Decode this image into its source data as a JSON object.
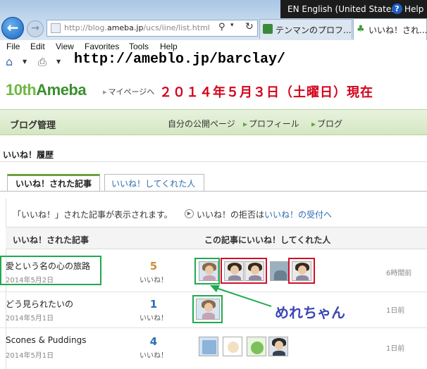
{
  "browser": {
    "language": "EN English (United States)",
    "help": "Help",
    "url_prefix": "http://blog.",
    "url_domain": "ameba.jp",
    "url_path": "/ucs/iine/list.html",
    "tabs": [
      {
        "label": "テンマンのプロフ..."
      },
      {
        "label": "いいね！され..."
      }
    ],
    "menu": [
      "File",
      "Edit",
      "View",
      "Favorites",
      "Tools",
      "Help"
    ],
    "overlay_url": "http://ameblo.jp/barclay/"
  },
  "site": {
    "logo_prefix": "10th",
    "logo_name": "Ameba",
    "mypage_link": "マイページへ",
    "date_note": "２０１４年５月３日（土曜日）現在"
  },
  "nav": {
    "title": "ブログ管理",
    "links": [
      "自分の公開ページ",
      "プロフィール",
      "ブログ"
    ]
  },
  "page": {
    "heading": "いいね！履歴",
    "tabs": [
      "いいね！された記事",
      "いいね！してくれた人"
    ],
    "info": "「いいね！」された記事が表示されます。",
    "refuse_text": "いいね！の拒否は",
    "refuse_link": "いいね！の受付へ",
    "column_articles": "いいね！された記事",
    "column_people": "この記事にいいね！してくれた人",
    "like_unit": "いいね！"
  },
  "rows": [
    {
      "title": "愛という名の心の旅路",
      "date": "2014年5月2日",
      "count": "5",
      "count_color": "#c8903c",
      "time": "6時間前"
    },
    {
      "title": "どう見られたいの",
      "date": "2014年5月1日",
      "count": "1",
      "count_color": "#2a6fb6",
      "time": "1日前"
    },
    {
      "title": "Scones & Puddings",
      "date": "2014年5月1日",
      "count": "4",
      "count_color": "#2a6fb6",
      "time": "1日前"
    }
  ],
  "annotation": {
    "label": "めれちゃん",
    "color": "#3b46b5",
    "green": "#1faa4f",
    "red": "#d0102a"
  }
}
